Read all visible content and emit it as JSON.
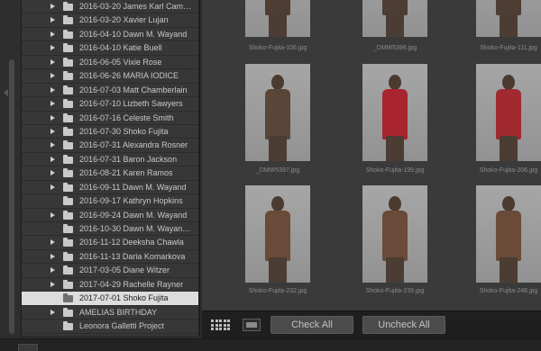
{
  "folders": [
    {
      "label": "2016-03-20 James Karl Campbell",
      "expandable": true,
      "selected": false
    },
    {
      "label": "2016-03-20 Xavier Lujan",
      "expandable": true,
      "selected": false
    },
    {
      "label": "2016-04-10 Dawn M. Wayand",
      "expandable": true,
      "selected": false
    },
    {
      "label": "2016-04-10 Katie Buell",
      "expandable": true,
      "selected": false
    },
    {
      "label": "2016-06-05 Vixie Rose",
      "expandable": true,
      "selected": false
    },
    {
      "label": "2016-06-26 MARIA IODICE",
      "expandable": true,
      "selected": false
    },
    {
      "label": "2016-07-03 Matt Chamberlain",
      "expandable": true,
      "selected": false
    },
    {
      "label": "2016-07-10 Lizbeth Sawyers",
      "expandable": true,
      "selected": false
    },
    {
      "label": "2016-07-16 Celeste Smith",
      "expandable": true,
      "selected": false
    },
    {
      "label": "2016-07-30 Shoko Fujita",
      "expandable": true,
      "selected": false
    },
    {
      "label": "2016-07-31 Alexandra Rosner",
      "expandable": true,
      "selected": false
    },
    {
      "label": "2016-07-31 Baron Jackson",
      "expandable": true,
      "selected": false
    },
    {
      "label": "2016-08-21 Karen Ramos",
      "expandable": true,
      "selected": false
    },
    {
      "label": "2016-09-11 Dawn M. Wayand",
      "expandable": true,
      "selected": false
    },
    {
      "label": "2016-09-17 Kathryn Hopkins",
      "expandable": false,
      "selected": false
    },
    {
      "label": "2016-09-24 Dawn M. Wayand",
      "expandable": true,
      "selected": false
    },
    {
      "label": "2016-10-30 Dawn M. Wayand (Se...",
      "expandable": false,
      "selected": false
    },
    {
      "label": "2016-11-12 Deeksha Chawla",
      "expandable": true,
      "selected": false
    },
    {
      "label": "2016-11-13 Daria Komarkova",
      "expandable": true,
      "selected": false
    },
    {
      "label": "2017-03-05 Diane Witzer",
      "expandable": true,
      "selected": false
    },
    {
      "label": "2017-04-29 Rachelle Rayner",
      "expandable": true,
      "selected": false
    },
    {
      "label": "2017-07-01 Shoko Fujita",
      "expandable": false,
      "selected": true
    },
    {
      "label": "AMELIAS BIRTHDAY",
      "expandable": true,
      "selected": false
    },
    {
      "label": "Leonora Galletti Project",
      "expandable": false,
      "selected": false
    }
  ],
  "thumbnails": [
    {
      "filename": "Shoko-Fujita-106.jpg",
      "outfit": "#4d3d33"
    },
    {
      "filename": "_DMW5396.jpg",
      "outfit": "#4d3d33"
    },
    {
      "filename": "Shoko-Fujita-111.jpg",
      "outfit": "#4d3d33"
    },
    {
      "filename": "_DMW5397.jpg",
      "outfit": "#5a4638"
    },
    {
      "filename": "Shoko-Fujita-199.jpg",
      "outfit": "#a8242e"
    },
    {
      "filename": "Shoko-Fujita-206.jpg",
      "outfit": "#a02a30"
    },
    {
      "filename": "Shoko-Fujita-232.jpg",
      "outfit": "#6a4a38"
    },
    {
      "filename": "Shoko-Fujita-239.jpg",
      "outfit": "#6a4a38"
    },
    {
      "filename": "Shoko-Fujita-248.jpg",
      "outfit": "#6a4a38"
    }
  ],
  "toolbar": {
    "grid_view_icon": "grid-view-icon",
    "loupe_view_icon": "loupe-view-icon",
    "check_all_label": "Check All",
    "uncheck_all_label": "Uncheck All"
  },
  "colors": {
    "selected_row": "#dcdcdc",
    "panel": "#373737",
    "grid_background": "#3a3a3a"
  }
}
